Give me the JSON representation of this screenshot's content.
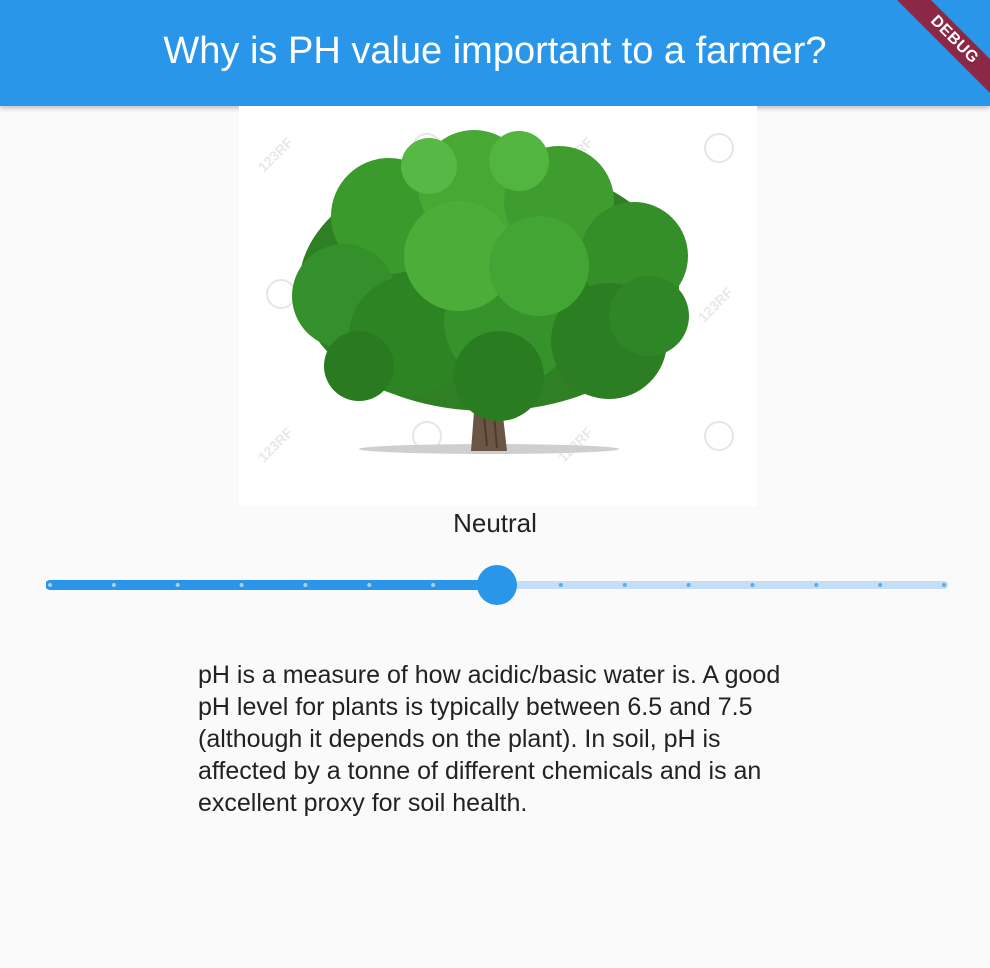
{
  "app_bar": {
    "title": "Why is PH value important to a farmer?",
    "background_color": "#2a96e9"
  },
  "debug_banner": {
    "label": "DEBUG",
    "color": "#8a2846"
  },
  "image": {
    "icon": "tree-image",
    "watermark": "123RF"
  },
  "ph_level": {
    "label": "Neutral"
  },
  "slider": {
    "min": 0,
    "max": 14,
    "divisions": 14,
    "value": 7,
    "active_color": "#2a96e9",
    "inactive_color": "#c3def6"
  },
  "description": {
    "text": "pH is a measure of how acidic/basic water is. A good pH level for plants is typically between 6.5 and 7.5 (although it depends on the plant). In soil, pH is affected by a tonne of different chemicals and is an excellent proxy for soil health."
  }
}
